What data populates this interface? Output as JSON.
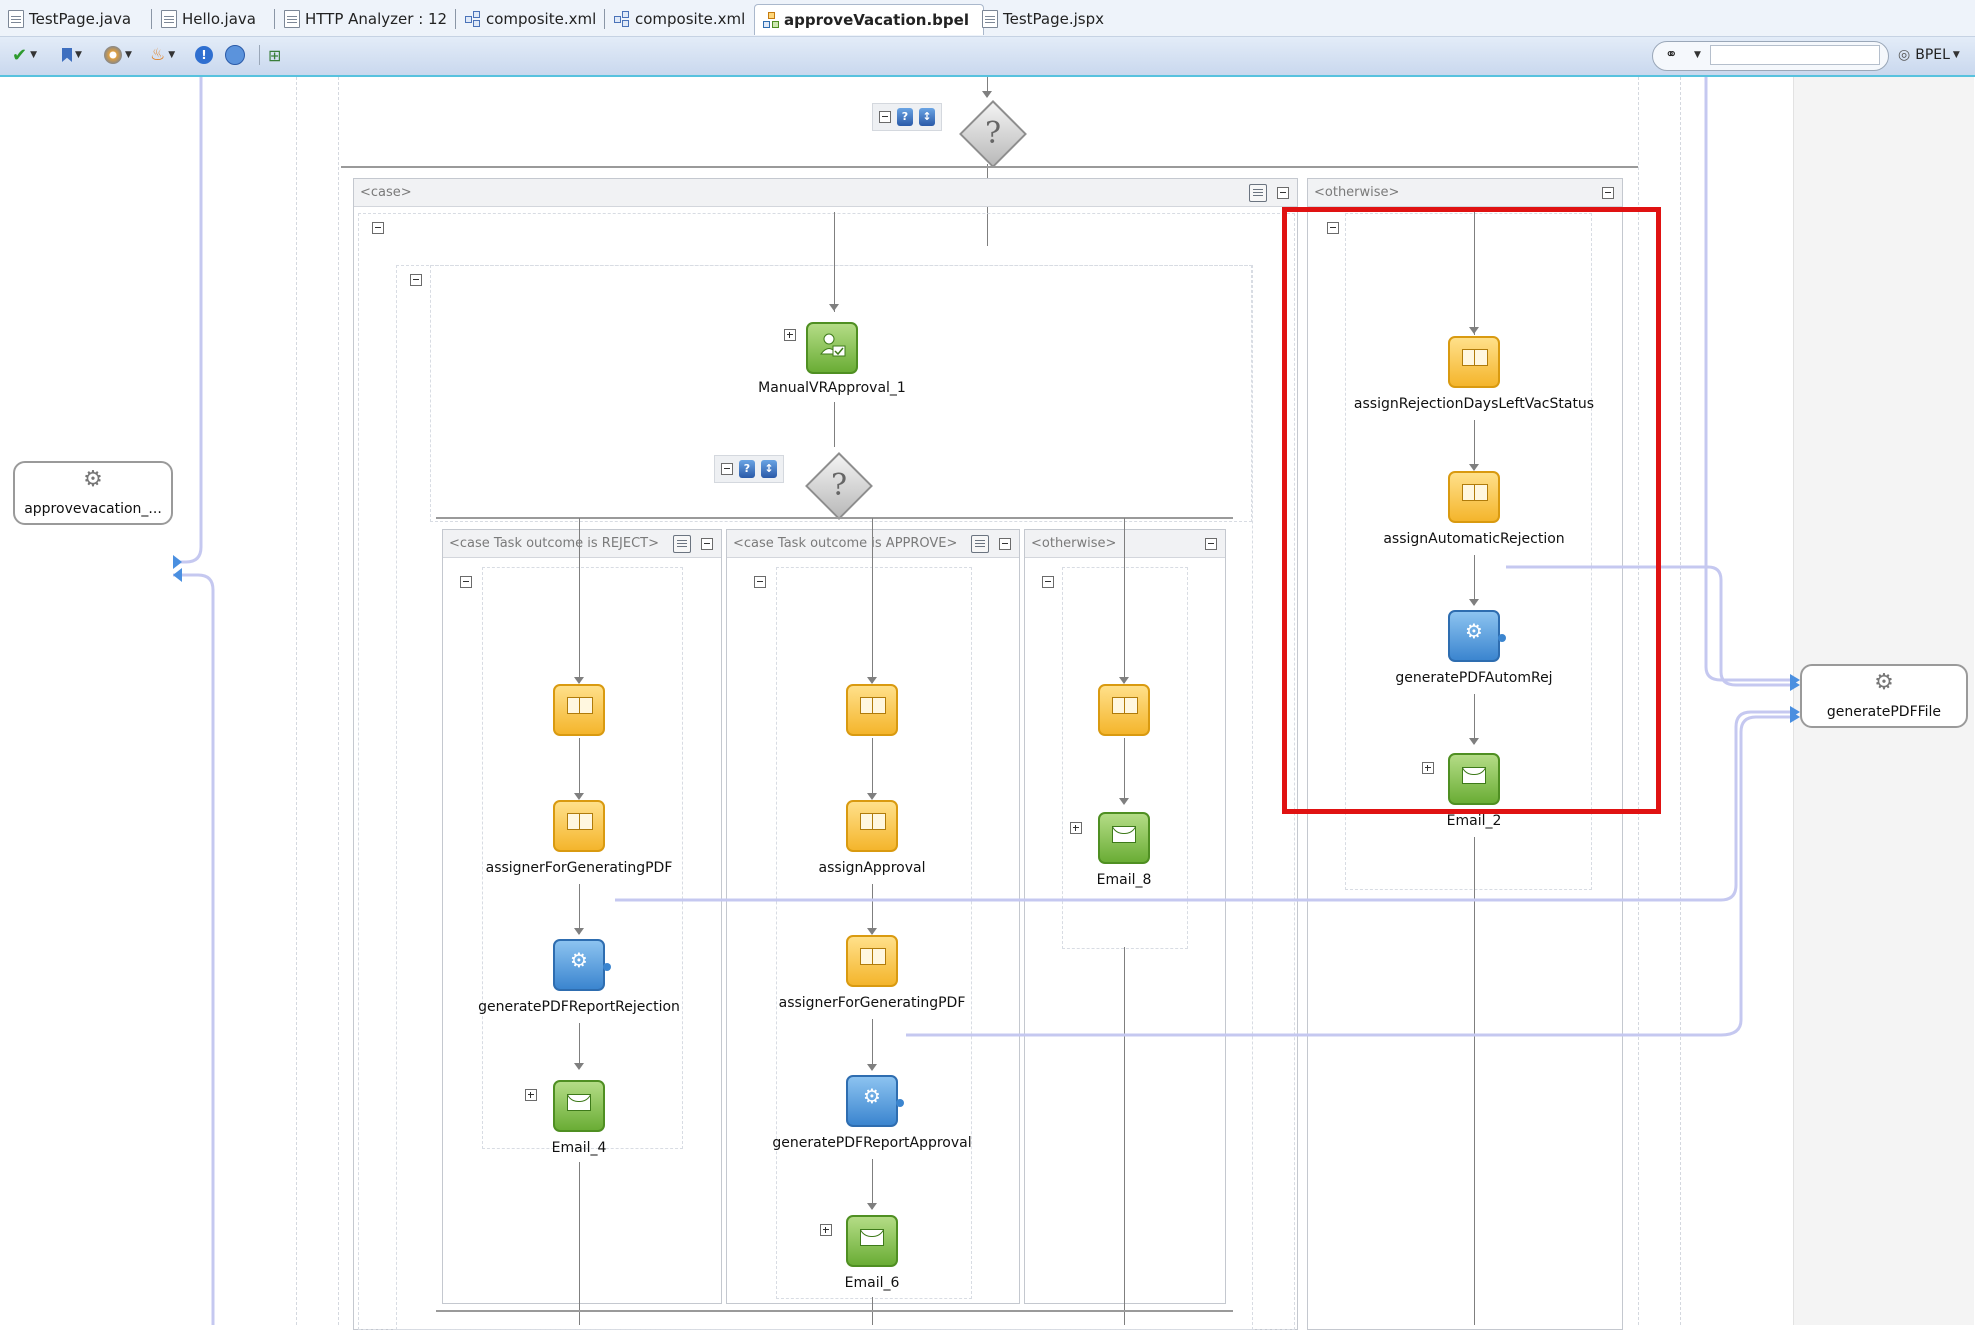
{
  "tabs": [
    {
      "label": "TestPage.java",
      "icon": "java-file-icon"
    },
    {
      "label": "Hello.java",
      "icon": "java-file-icon"
    },
    {
      "label": "HTTP Analyzer : 12",
      "icon": "http-analyzer-icon"
    },
    {
      "label": "composite.xml",
      "icon": "composite-icon"
    },
    {
      "label": "composite.xml",
      "icon": "composite-icon"
    },
    {
      "label": "approveVacation.bpel",
      "icon": "bpel-icon",
      "active": true
    },
    {
      "label": "TestPage.jspx",
      "icon": "jspx-file-icon"
    }
  ],
  "toolbar": {
    "search_placeholder": "",
    "bpel_label": "BPEL"
  },
  "top_switch": {
    "case_label": "<case>",
    "otherwise_label": "<otherwise>"
  },
  "inner_switch": {
    "reject_label": "<case Task outcome is REJECT>",
    "approve_label": "<case Task outcome is APPROVE>",
    "otherwise_label": "<otherwise>"
  },
  "activities": {
    "manual_approval": "ManualVRApproval_1",
    "reject": {
      "assign": "assignerForGeneratingPDF",
      "invoke": "generatePDFReportRejection",
      "email": "Email_4"
    },
    "approve": {
      "assign1": "assignApproval",
      "assign2": "assignerForGeneratingPDF",
      "invoke": "generatePDFReportApproval",
      "email": "Email_6"
    },
    "inner_otherwise": {
      "email": "Email_8"
    },
    "otherwise": {
      "assign1": "assignRejectionDaysLeftVacStatus",
      "assign2": "assignAutomaticRejection",
      "invoke": "generatePDFAutomRej",
      "email": "Email_2"
    }
  },
  "partner_links": {
    "left": "approvevacation_...",
    "right": "generatePDFFile"
  },
  "colors": {
    "highlight": "#e01212",
    "wire": "#c5c8f0",
    "assign": "#f4b52c",
    "invoke": "#3b85cf",
    "email": "#6aad35"
  }
}
